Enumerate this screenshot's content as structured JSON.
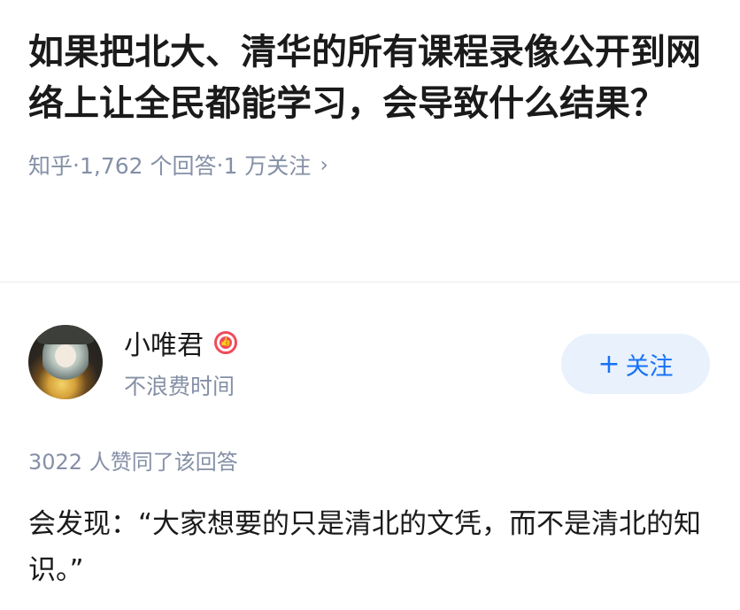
{
  "question": {
    "title": "如果把北大、清华的所有课程录像公开到网络上让全民都能学习，会导致什么结果？",
    "source": "知乎",
    "answer_count": "1,762 个回答",
    "follower_count": "1 万关注",
    "separator": "·",
    "chevron_icon": "chevron-right-icon"
  },
  "author": {
    "name": "小唯君",
    "badge_icon": "thumbs-up-badge-icon",
    "bio": "不浪费时间",
    "follow_label": "关注",
    "follow_plus": "+"
  },
  "answer": {
    "votes": "3022 人赞同了该回答",
    "content": "会发现：“大家想要的只是清北的文凭，而不是清北的知识。”"
  },
  "colors": {
    "accent": "#1772f6",
    "follow_bg": "#e8f1fc",
    "meta_gray": "#8590a6",
    "badge_red": "#f04b5a"
  }
}
